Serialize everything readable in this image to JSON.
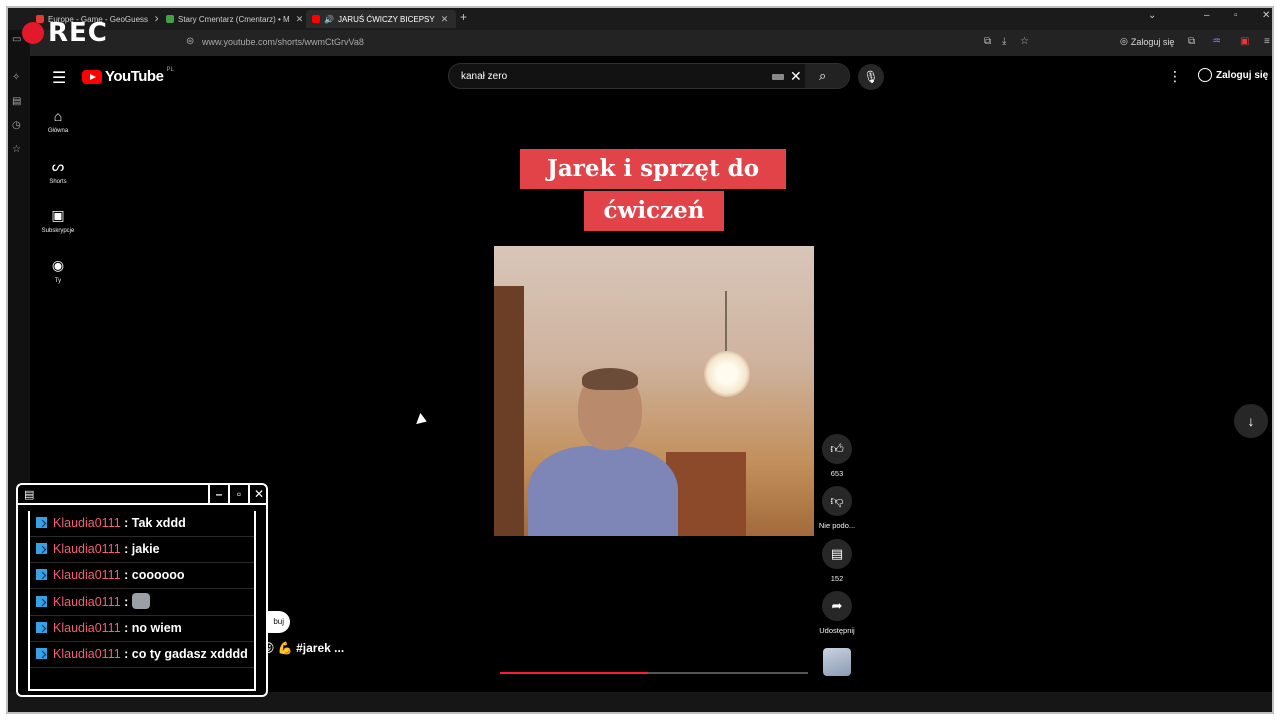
{
  "recording": {
    "label": "REC"
  },
  "tabs": [
    {
      "title": "Europe - Game - GeoGuess",
      "fav_color": "#e53935"
    },
    {
      "title": "Stary Cmentarz (Cmentarz) • M",
      "fav_color": "#43a047"
    },
    {
      "title": "JARUŚ ĆWICZY BICEPSY",
      "fav_color": "#ff0000"
    }
  ],
  "browser": {
    "url": "www.youtube.com/shorts/wwmCtGrvVa8",
    "login_label": "Zaloguj się"
  },
  "youtube": {
    "logo_text": "YouTube",
    "country_code": "PL",
    "search_query": "kanał zero",
    "login_label": "Zaloguj się",
    "sidebar": [
      {
        "label": "Główna",
        "icon": "home-icon"
      },
      {
        "label": "Shorts",
        "icon": "shorts-icon"
      },
      {
        "label": "Subskrypcje",
        "icon": "subscriptions-icon"
      },
      {
        "label": "Ty",
        "icon": "account-icon"
      }
    ]
  },
  "video": {
    "caption_line1": "Jarek i sprzęt do",
    "caption_line2": "ćwiczeń",
    "progress": 0.48,
    "hashtag": "#jarek ...",
    "subscribe_partial": "buj"
  },
  "actions": {
    "likes": "653",
    "dislike_label": "Nie podo...",
    "comments": "152",
    "share_label": "Udostępnij"
  },
  "chat": {
    "messages": [
      {
        "user": "Klaudia0111",
        "text": "Tak xddd"
      },
      {
        "user": "Klaudia0111",
        "text": "jakie"
      },
      {
        "user": "Klaudia0111",
        "text": "coooooo"
      },
      {
        "user": "Klaudia0111",
        "text": "",
        "emote": "cat-emote"
      },
      {
        "user": "Klaudia0111",
        "text": "no wiem"
      },
      {
        "user": "Klaudia0111",
        "text": "co ty gadasz xdddd"
      }
    ]
  },
  "colors": {
    "accent_red": "#ff0000",
    "caption_bg": "#e14349",
    "chat_username": "#f16073"
  }
}
